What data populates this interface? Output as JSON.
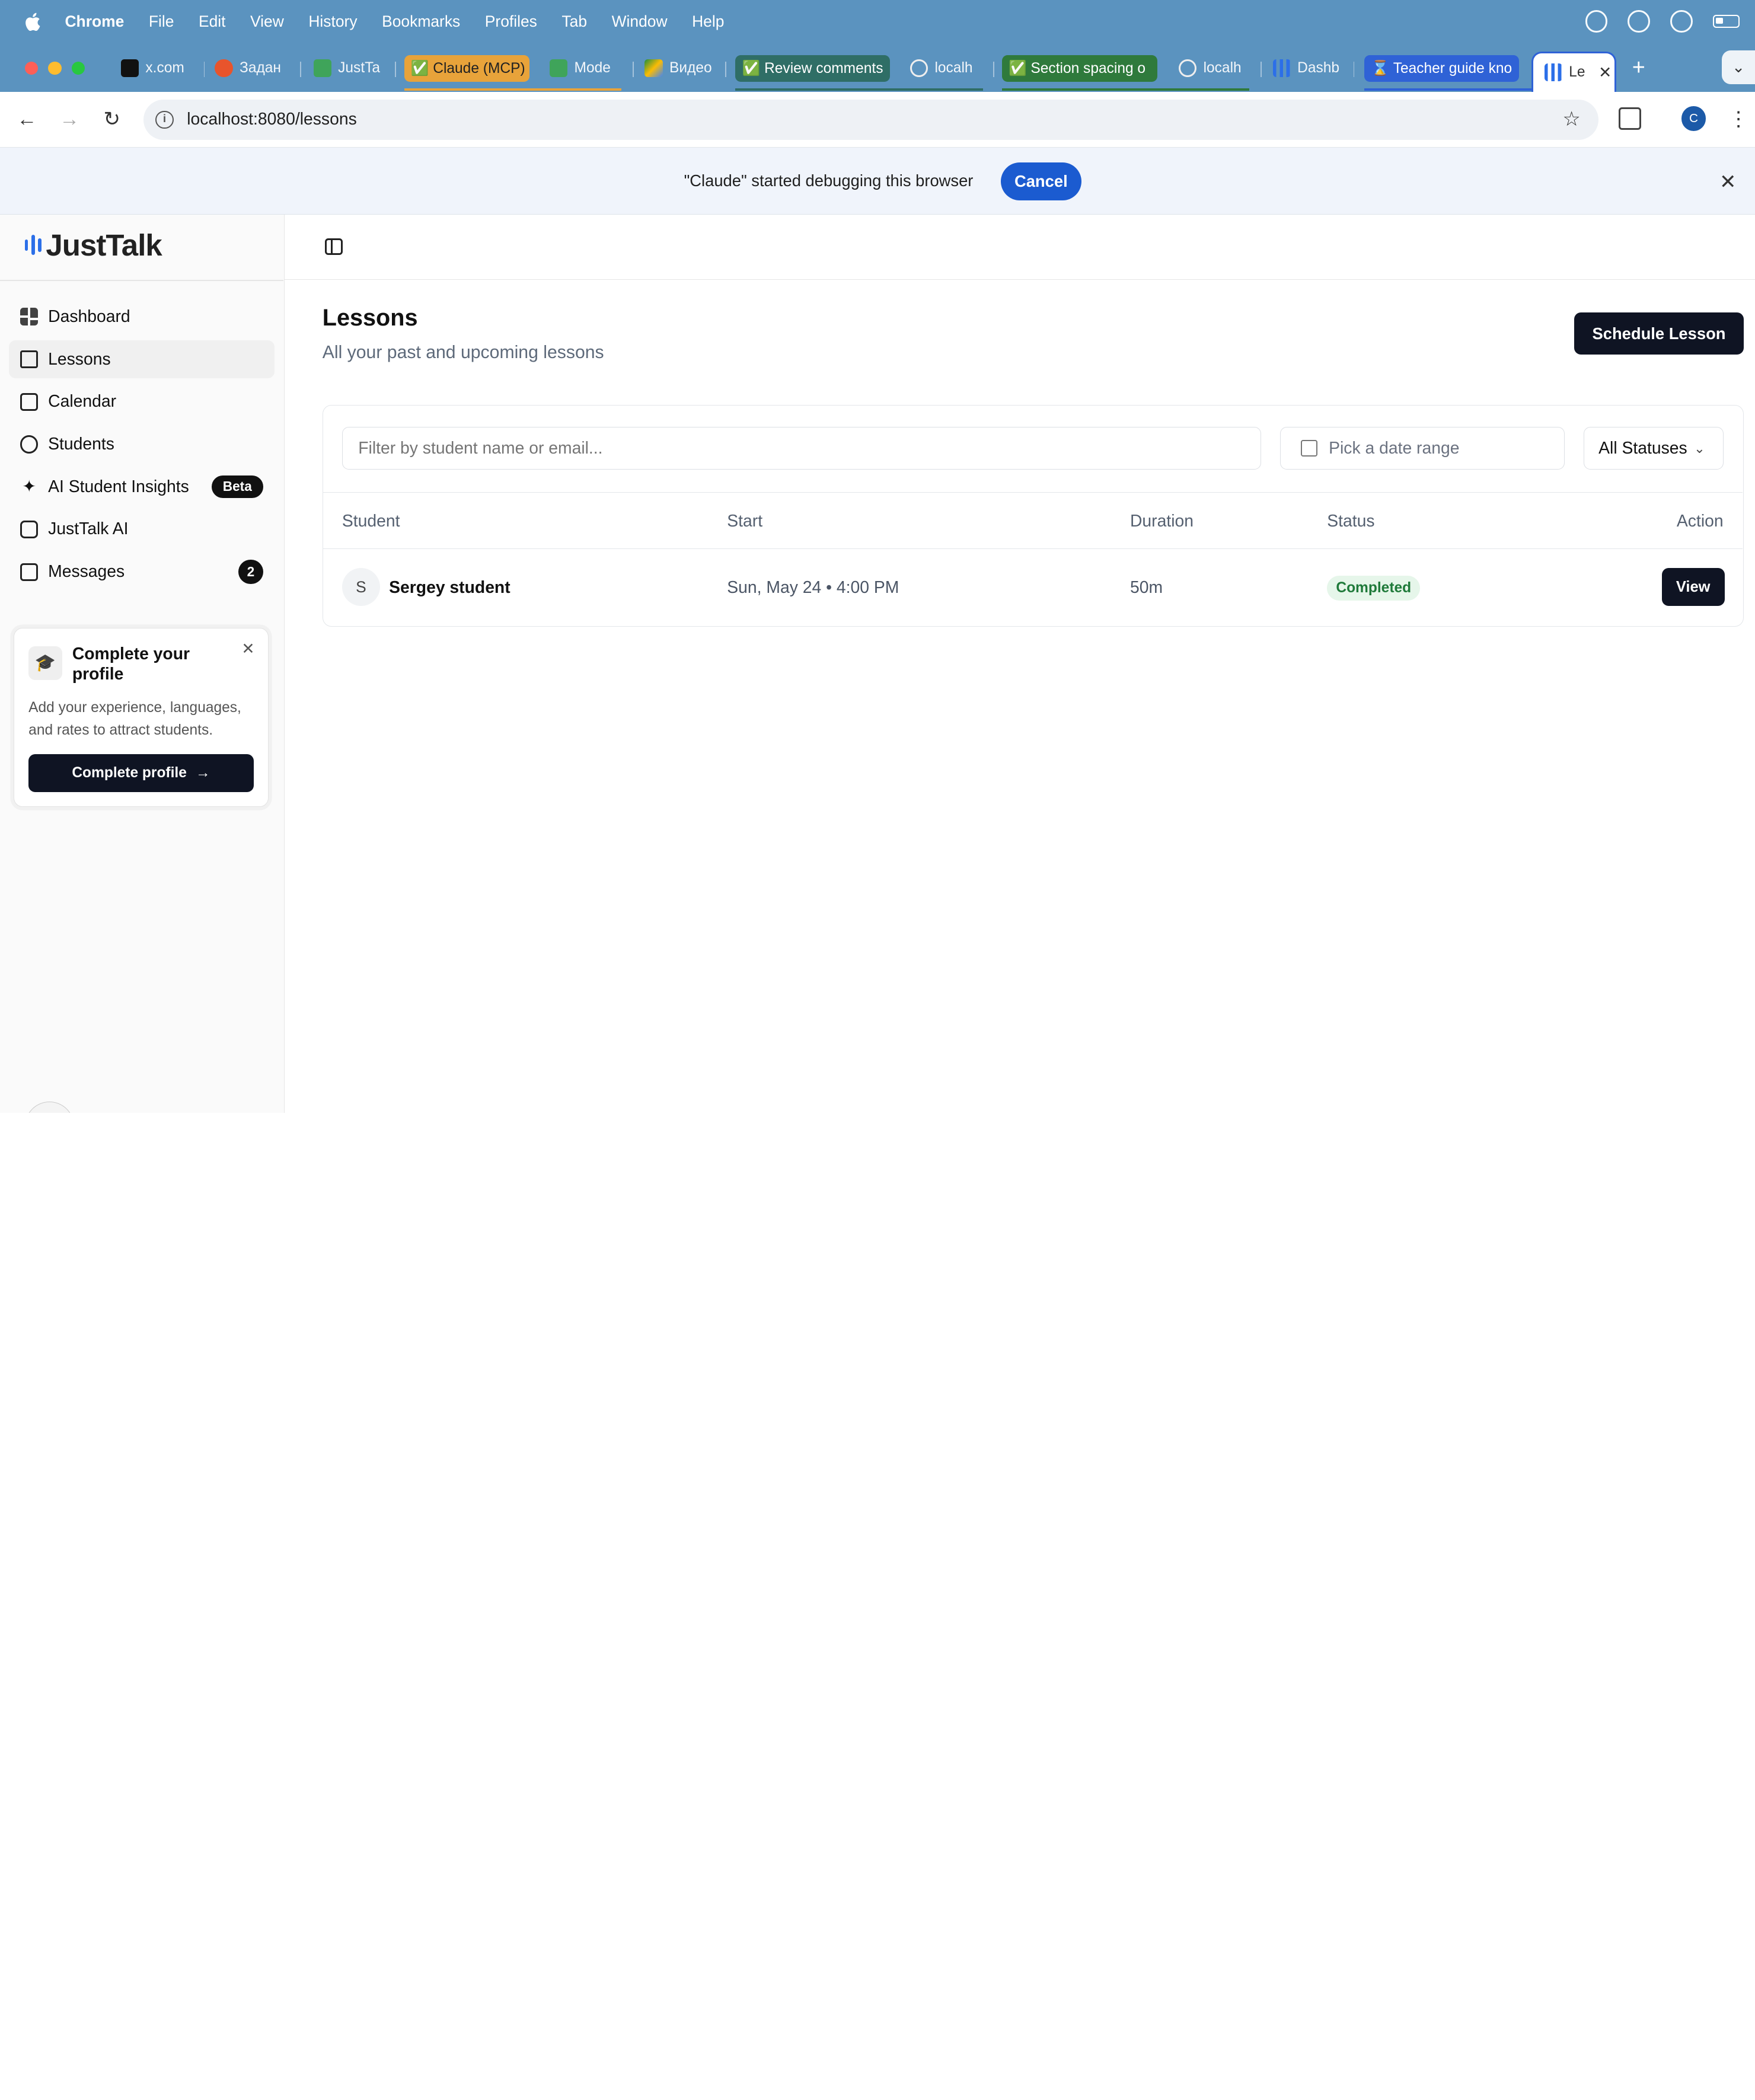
{
  "menubar": {
    "app": "Chrome",
    "items": [
      "File",
      "Edit",
      "View",
      "History",
      "Bookmarks",
      "Profiles",
      "Tab",
      "Window",
      "Help"
    ]
  },
  "tabs": [
    {
      "label": "x.com"
    },
    {
      "label": "Задан"
    },
    {
      "label": "JustTa"
    },
    {
      "label": "✅ Claude (MCP)"
    },
    {
      "label": "Mode"
    },
    {
      "label": "Видео"
    },
    {
      "label": "✅ Review comments"
    },
    {
      "label": "localh"
    },
    {
      "label": "✅ Section spacing o"
    },
    {
      "label": "localh"
    },
    {
      "label": "Dashb"
    },
    {
      "label": "⌛ Teacher guide kno"
    },
    {
      "label": "Le"
    }
  ],
  "toolbar": {
    "url": "localhost:8080/lessons",
    "profile_initial": "C"
  },
  "debugbar": {
    "message": "\"Claude\" started debugging this browser",
    "cancel_label": "Cancel"
  },
  "sidebar": {
    "logo": "JustTalk",
    "items": [
      {
        "label": "Dashboard"
      },
      {
        "label": "Lessons"
      },
      {
        "label": "Calendar"
      },
      {
        "label": "Students"
      },
      {
        "label": "AI Student Insights",
        "badge": "Beta"
      },
      {
        "label": "JustTalk AI"
      },
      {
        "label": "Messages",
        "count": "2"
      }
    ],
    "promo": {
      "title": "Complete your profile",
      "description": "Add your experience, languages, and rates to attract students.",
      "cta": "Complete profile"
    }
  },
  "page": {
    "title": "Lessons",
    "subtitle": "All your past and upcoming lessons",
    "schedule_label": "Schedule Lesson"
  },
  "filters": {
    "search_placeholder": "Filter by student name or email...",
    "date_placeholder": "Pick a date range",
    "status_value": "All Statuses"
  },
  "table": {
    "headers": [
      "Student",
      "Start",
      "Duration",
      "Status",
      "Action"
    ],
    "rows": [
      {
        "initial": "S",
        "student": "Sergey student",
        "start": "Sun, May 24 • 4:00 PM",
        "duration": "50m",
        "status": "Completed",
        "action": "View"
      }
    ]
  },
  "colors": {
    "accent": "#1b5bd0",
    "brand": "#2c6fe8",
    "primary_button": "#0f1423",
    "status_completed": "#1f7a3a"
  }
}
